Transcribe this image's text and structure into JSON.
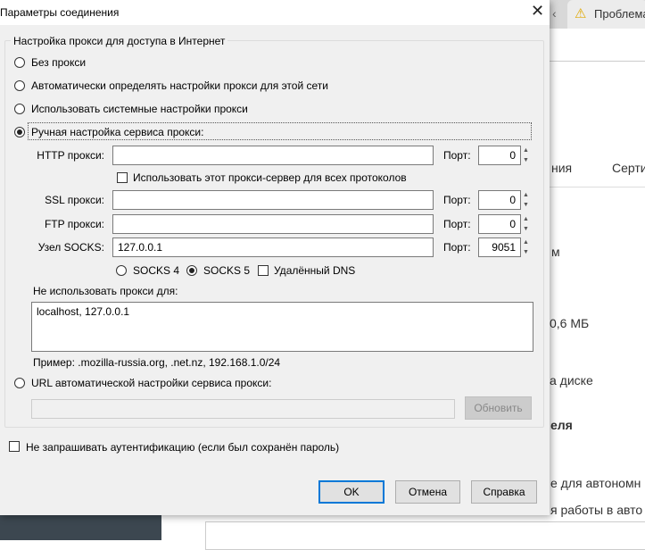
{
  "background": {
    "tab_label": "Проблема",
    "texts": [
      "ния",
      "Серти",
      "м",
      "0,6 МБ",
      "а диске",
      "еля",
      "е для автономн",
      "я работы в авто"
    ]
  },
  "dialog": {
    "title": "Параметры соединения",
    "group_title": "Настройка прокси для доступа в Интернет",
    "options": {
      "no_proxy": "Без прокси",
      "auto_detect": "Автоматически определять настройки прокси для этой сети",
      "system": "Использовать системные настройки прокси",
      "manual": "Ручная настройка сервиса прокси:",
      "pac_url": "URL автоматической настройки сервиса прокси:"
    },
    "selected_option": "manual",
    "port_label": "Порт:",
    "http": {
      "label": "HTTP прокси:",
      "value": "",
      "port": "0"
    },
    "use_for_all": {
      "label": "Использовать этот прокси-сервер для всех протоколов",
      "checked": false
    },
    "ssl": {
      "label": "SSL прокси:",
      "value": "",
      "port": "0"
    },
    "ftp": {
      "label": "FTP прокси:",
      "value": "",
      "port": "0"
    },
    "socks": {
      "label": "Узел SOCKS:",
      "value": "127.0.0.1",
      "port": "9051"
    },
    "socks4": "SOCKS 4",
    "socks5": "SOCKS 5",
    "socks_version": "5",
    "remote_dns": {
      "label": "Удалённый DNS",
      "checked": false
    },
    "no_proxy_for_label": "Не использовать прокси для:",
    "no_proxy_for_value": "localhost, 127.0.0.1",
    "example": "Пример: .mozilla-russia.org, .net.nz, 192.168.1.0/24",
    "pac_url_value": "",
    "reload_button": "Обновить",
    "no_auth": {
      "label": "Не запрашивать аутентификацию (если был сохранён пароль)",
      "checked": false
    },
    "ok": "OK",
    "cancel": "Отмена",
    "help": "Справка"
  }
}
